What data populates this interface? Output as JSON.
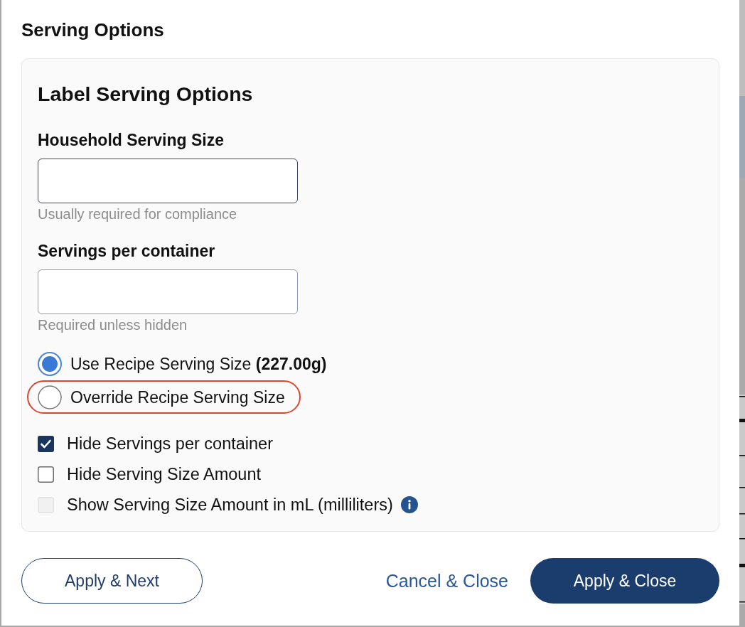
{
  "dialog": {
    "title": "Serving Options"
  },
  "panel": {
    "heading": "Label Serving Options",
    "fields": [
      {
        "label": "Household Serving Size",
        "hint": "Usually required for compliance",
        "focused": true
      },
      {
        "label": "Servings per container",
        "hint": "Required unless hidden",
        "focused": false
      }
    ],
    "radios": [
      {
        "label": "Use Recipe Serving Size **(227.00g)**",
        "selected": true,
        "highlighted": false
      },
      {
        "label": "Override Recipe Serving Size",
        "selected": false,
        "highlighted": true
      }
    ],
    "checkboxes": [
      {
        "label": "Hide Servings per container",
        "checked": true,
        "disabled": false,
        "info": false
      },
      {
        "label": "Hide Serving Size Amount",
        "checked": false,
        "disabled": false,
        "info": false
      },
      {
        "label": "Show Serving Size Amount in mL (milliliters)",
        "checked": false,
        "disabled": true,
        "info": true
      }
    ]
  },
  "buttons": [
    {
      "label": "Apply & Next",
      "kind": "outline"
    },
    {
      "label": "Cancel & Close",
      "kind": "link"
    },
    {
      "label": "Apply & Close",
      "kind": "primary"
    }
  ]
}
